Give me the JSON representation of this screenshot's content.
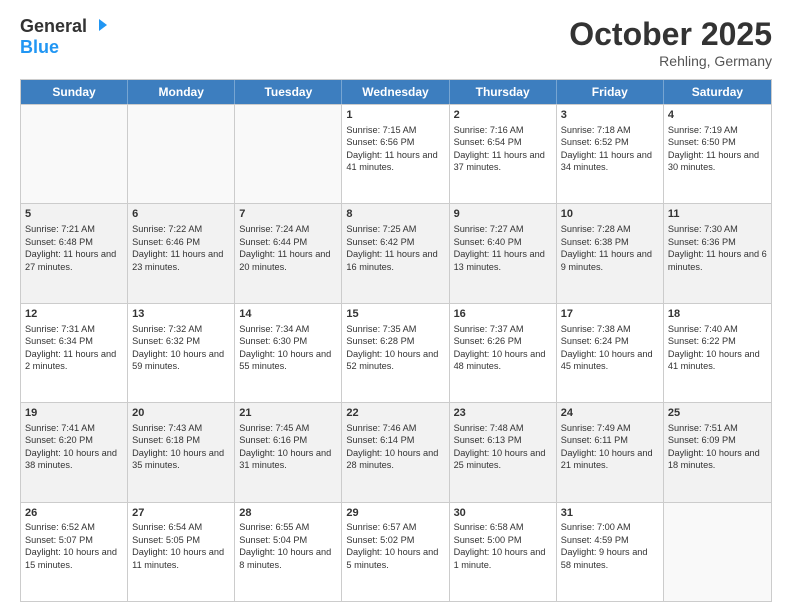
{
  "header": {
    "logo_line1": "General",
    "logo_line2": "Blue",
    "month": "October 2025",
    "location": "Rehling, Germany"
  },
  "day_headers": [
    "Sunday",
    "Monday",
    "Tuesday",
    "Wednesday",
    "Thursday",
    "Friday",
    "Saturday"
  ],
  "weeks": [
    [
      {
        "day": "",
        "text": ""
      },
      {
        "day": "",
        "text": ""
      },
      {
        "day": "",
        "text": ""
      },
      {
        "day": "1",
        "text": "Sunrise: 7:15 AM\nSunset: 6:56 PM\nDaylight: 11 hours and 41 minutes."
      },
      {
        "day": "2",
        "text": "Sunrise: 7:16 AM\nSunset: 6:54 PM\nDaylight: 11 hours and 37 minutes."
      },
      {
        "day": "3",
        "text": "Sunrise: 7:18 AM\nSunset: 6:52 PM\nDaylight: 11 hours and 34 minutes."
      },
      {
        "day": "4",
        "text": "Sunrise: 7:19 AM\nSunset: 6:50 PM\nDaylight: 11 hours and 30 minutes."
      }
    ],
    [
      {
        "day": "5",
        "text": "Sunrise: 7:21 AM\nSunset: 6:48 PM\nDaylight: 11 hours and 27 minutes."
      },
      {
        "day": "6",
        "text": "Sunrise: 7:22 AM\nSunset: 6:46 PM\nDaylight: 11 hours and 23 minutes."
      },
      {
        "day": "7",
        "text": "Sunrise: 7:24 AM\nSunset: 6:44 PM\nDaylight: 11 hours and 20 minutes."
      },
      {
        "day": "8",
        "text": "Sunrise: 7:25 AM\nSunset: 6:42 PM\nDaylight: 11 hours and 16 minutes."
      },
      {
        "day": "9",
        "text": "Sunrise: 7:27 AM\nSunset: 6:40 PM\nDaylight: 11 hours and 13 minutes."
      },
      {
        "day": "10",
        "text": "Sunrise: 7:28 AM\nSunset: 6:38 PM\nDaylight: 11 hours and 9 minutes."
      },
      {
        "day": "11",
        "text": "Sunrise: 7:30 AM\nSunset: 6:36 PM\nDaylight: 11 hours and 6 minutes."
      }
    ],
    [
      {
        "day": "12",
        "text": "Sunrise: 7:31 AM\nSunset: 6:34 PM\nDaylight: 11 hours and 2 minutes."
      },
      {
        "day": "13",
        "text": "Sunrise: 7:32 AM\nSunset: 6:32 PM\nDaylight: 10 hours and 59 minutes."
      },
      {
        "day": "14",
        "text": "Sunrise: 7:34 AM\nSunset: 6:30 PM\nDaylight: 10 hours and 55 minutes."
      },
      {
        "day": "15",
        "text": "Sunrise: 7:35 AM\nSunset: 6:28 PM\nDaylight: 10 hours and 52 minutes."
      },
      {
        "day": "16",
        "text": "Sunrise: 7:37 AM\nSunset: 6:26 PM\nDaylight: 10 hours and 48 minutes."
      },
      {
        "day": "17",
        "text": "Sunrise: 7:38 AM\nSunset: 6:24 PM\nDaylight: 10 hours and 45 minutes."
      },
      {
        "day": "18",
        "text": "Sunrise: 7:40 AM\nSunset: 6:22 PM\nDaylight: 10 hours and 41 minutes."
      }
    ],
    [
      {
        "day": "19",
        "text": "Sunrise: 7:41 AM\nSunset: 6:20 PM\nDaylight: 10 hours and 38 minutes."
      },
      {
        "day": "20",
        "text": "Sunrise: 7:43 AM\nSunset: 6:18 PM\nDaylight: 10 hours and 35 minutes."
      },
      {
        "day": "21",
        "text": "Sunrise: 7:45 AM\nSunset: 6:16 PM\nDaylight: 10 hours and 31 minutes."
      },
      {
        "day": "22",
        "text": "Sunrise: 7:46 AM\nSunset: 6:14 PM\nDaylight: 10 hours and 28 minutes."
      },
      {
        "day": "23",
        "text": "Sunrise: 7:48 AM\nSunset: 6:13 PM\nDaylight: 10 hours and 25 minutes."
      },
      {
        "day": "24",
        "text": "Sunrise: 7:49 AM\nSunset: 6:11 PM\nDaylight: 10 hours and 21 minutes."
      },
      {
        "day": "25",
        "text": "Sunrise: 7:51 AM\nSunset: 6:09 PM\nDaylight: 10 hours and 18 minutes."
      }
    ],
    [
      {
        "day": "26",
        "text": "Sunrise: 6:52 AM\nSunset: 5:07 PM\nDaylight: 10 hours and 15 minutes."
      },
      {
        "day": "27",
        "text": "Sunrise: 6:54 AM\nSunset: 5:05 PM\nDaylight: 10 hours and 11 minutes."
      },
      {
        "day": "28",
        "text": "Sunrise: 6:55 AM\nSunset: 5:04 PM\nDaylight: 10 hours and 8 minutes."
      },
      {
        "day": "29",
        "text": "Sunrise: 6:57 AM\nSunset: 5:02 PM\nDaylight: 10 hours and 5 minutes."
      },
      {
        "day": "30",
        "text": "Sunrise: 6:58 AM\nSunset: 5:00 PM\nDaylight: 10 hours and 1 minute."
      },
      {
        "day": "31",
        "text": "Sunrise: 7:00 AM\nSunset: 4:59 PM\nDaylight: 9 hours and 58 minutes."
      },
      {
        "day": "",
        "text": ""
      }
    ]
  ]
}
